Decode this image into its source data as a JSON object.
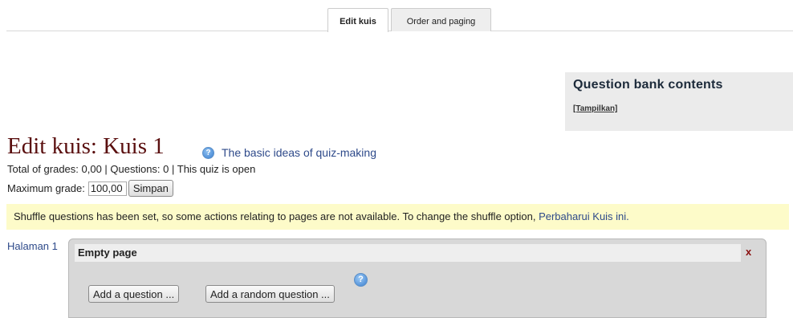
{
  "tabs": {
    "edit": "Edit kuis",
    "order": "Order and paging"
  },
  "question_bank": {
    "title": "Question bank contents",
    "show_link": "[Tampilkan]"
  },
  "heading": {
    "title": "Edit kuis: Kuis 1",
    "help_link": "The basic ideas of quiz-making",
    "help_icon_glyph": "?"
  },
  "summary": {
    "text": "Total of grades: 0,00 | Questions: 0 | This quiz is open"
  },
  "max_grade": {
    "label": "Maximum grade:",
    "value": "100,00",
    "save_button": "Simpan"
  },
  "notice": {
    "text": "Shuffle questions has been set, so some actions relating to pages are not available. To change the shuffle option, ",
    "link": "Perbaharui Kuis ini."
  },
  "page_section": {
    "page_label": "Halaman 1",
    "header": "Empty page",
    "close_glyph": "x",
    "add_question_button": "Add a question ...",
    "add_random_button": "Add a random question ...",
    "help_icon_glyph": "?"
  },
  "colors": {
    "title": "#5a0f0f",
    "link": "#2e4a8a",
    "notice_bg": "#fdfbc9",
    "close": "#8a1010"
  }
}
